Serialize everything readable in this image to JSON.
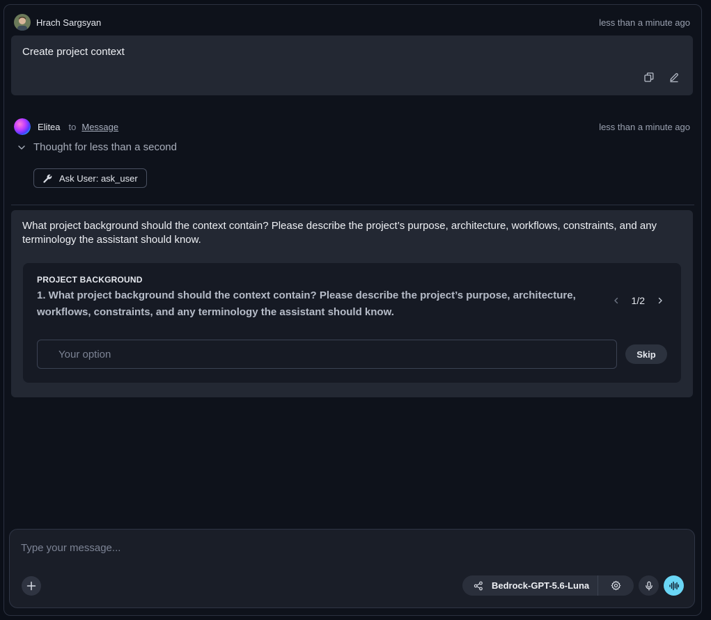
{
  "user_message": {
    "author": "Hrach Sargsyan",
    "time": "less than a minute ago",
    "text": "Create project context",
    "actions": [
      "copy-icon",
      "edit-icon"
    ]
  },
  "assistant_message": {
    "author": "Elitea",
    "to_label": "to",
    "target": "Message",
    "time": "less than a minute ago",
    "thought": "Thought for less than a second",
    "tool_chip": "Ask User: ask_user",
    "text": "What project background should the context contain? Please describe the project’s purpose, architecture, workflows, constraints, and any terminology the assistant should know.",
    "question_card": {
      "title": "PROJECT BACKGROUND",
      "question": "1. What project background should the context contain? Please describe the project’s purpose, architecture, workflows, constraints, and any terminology the assistant should know.",
      "pager": "1/2",
      "input_placeholder": "Your option",
      "skip_label": "Skip"
    }
  },
  "composer": {
    "placeholder": "Type your message...",
    "model": "Bedrock-GPT-5.6-Luna",
    "icons": [
      "plus-icon",
      "share-icon",
      "gear-icon",
      "mic-icon",
      "voice-wave-icon"
    ]
  },
  "colors": {
    "background": "#0e121b",
    "bubble": "#232833",
    "card": "#161a24",
    "accent": "#6ad6f5"
  }
}
